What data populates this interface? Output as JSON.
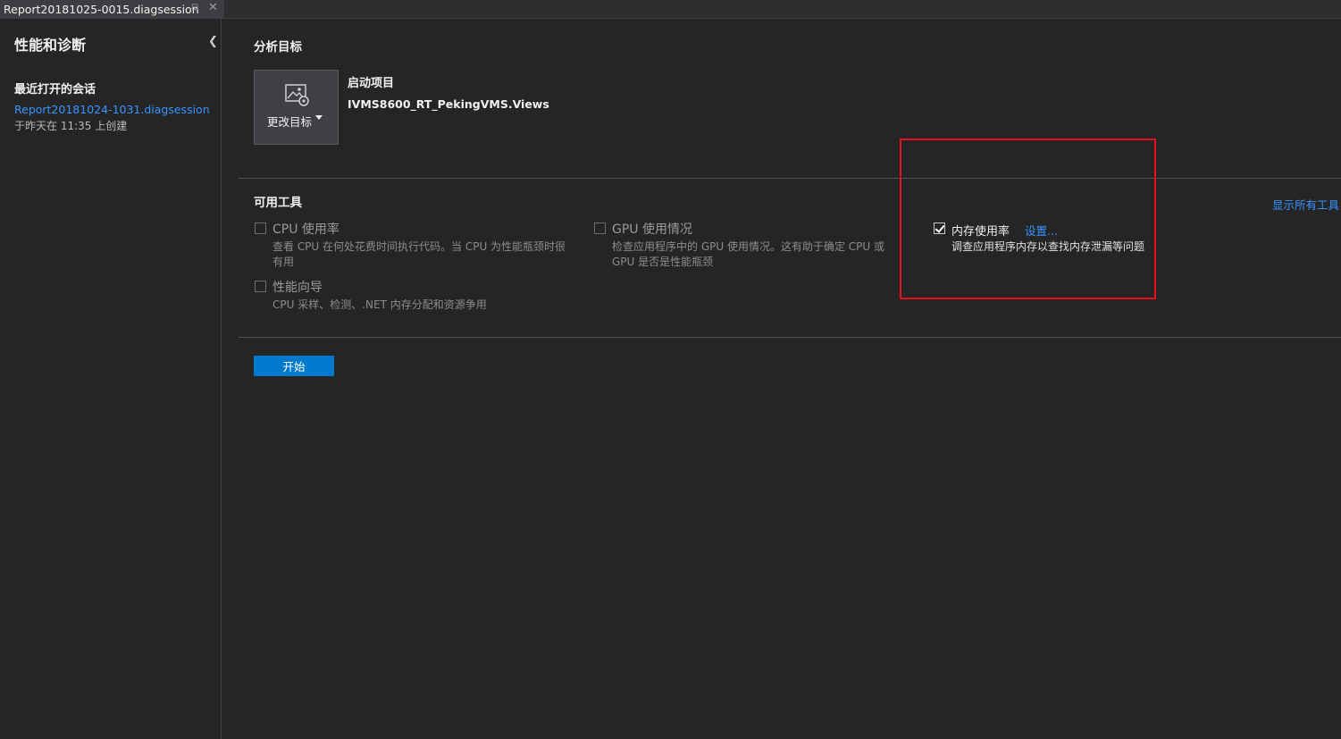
{
  "tab": {
    "title": "Report20181025-0015.diagsession",
    "pin_icon": "pin-icon",
    "close_icon": "close-icon"
  },
  "sidebar": {
    "title": "性能和诊断",
    "recent_heading": "最近打开的会话",
    "recent_sessions": [
      {
        "name": "Report20181024-1031.diagsession",
        "meta": "于昨天在 11:35 上创建"
      }
    ]
  },
  "analysis_target": {
    "heading": "分析目标",
    "change_target_label": "更改目标",
    "startup_label": "启动项目",
    "startup_value": "IVMS8600_RT_PekingVMS.Views"
  },
  "available_tools": {
    "heading": "可用工具",
    "show_all_link": "显示所有工具",
    "tools": [
      {
        "name": "CPU 使用率",
        "checked": false,
        "enabled": false,
        "description": "查看 CPU 在何处花费时间执行代码。当 CPU 为性能瓶颈时很有用"
      },
      {
        "name": "GPU 使用情况",
        "checked": false,
        "enabled": false,
        "description": "检查应用程序中的 GPU 使用情况。这有助于确定 CPU 或 GPU 是否是性能瓶颈"
      },
      {
        "name": "内存使用率",
        "checked": true,
        "enabled": true,
        "settings_link": "设置...",
        "description": "调查应用程序内存以查找内存泄漏等问题"
      },
      {
        "name": "性能向导",
        "checked": false,
        "enabled": false,
        "description": "CPU 采样、检测、.NET 内存分配和资源争用"
      }
    ]
  },
  "start_button": "开始",
  "colors": {
    "background": "#252526",
    "accent": "#007acc",
    "link": "#3794ff",
    "highlight": "#e81123"
  }
}
